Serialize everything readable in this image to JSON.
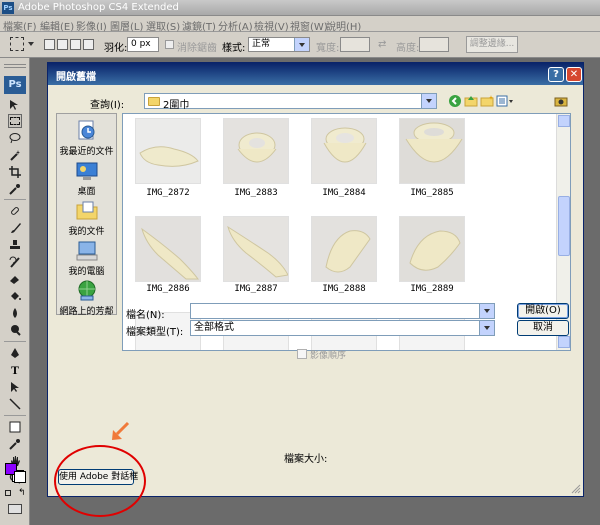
{
  "app": {
    "title": "Adobe Photoshop CS4 Extended",
    "logo": "Ps"
  },
  "menubar": [
    "檔案(F)",
    "編輯(E)",
    "影像(I)",
    "圖層(L)",
    "選取(S)",
    "濾鏡(T)",
    "分析(A)",
    "檢視(V)",
    "視窗(W)",
    "說明(H)"
  ],
  "options": {
    "feather_label": "羽化:",
    "feather_value": "0 px",
    "antialias_label": "消除鋸齒",
    "style_label": "樣式:",
    "style_value": "正常",
    "width_label": "寬度:",
    "height_label": "高度:",
    "refine_edge_label": "調整邊緣..."
  },
  "toolbox": {
    "logo": "Ps",
    "foreground_color": "#8b00ff",
    "background_color": "#ffffff"
  },
  "dialog": {
    "title": "開啟舊檔",
    "help_button": "?",
    "close_button": "✕",
    "look_in_label": "查詢(I):",
    "look_in_value": "2圍巾",
    "places": [
      {
        "label": "我最近的文件",
        "icon": "recent-documents-icon"
      },
      {
        "label": "桌面",
        "icon": "desktop-icon"
      },
      {
        "label": "我的文件",
        "icon": "my-documents-icon"
      },
      {
        "label": "我的電腦",
        "icon": "my-computer-icon"
      },
      {
        "label": "網路上的芳鄰",
        "icon": "network-places-icon"
      }
    ],
    "files": [
      "IMG_2872",
      "IMG_2883",
      "IMG_2884",
      "IMG_2885",
      "IMG_2886",
      "IMG_2887",
      "IMG_2888",
      "IMG_2889"
    ],
    "filename_label": "檔名(N):",
    "filename_value": "",
    "filetype_label": "檔案類型(T):",
    "filetype_value": "全部格式",
    "open_button": "開啟(O)",
    "cancel_button": "取消",
    "image_sequence_label": "影像順序",
    "file_size_label": "檔案大小:",
    "use_adobe_dialog_button": "使用 Adobe 對話框"
  }
}
